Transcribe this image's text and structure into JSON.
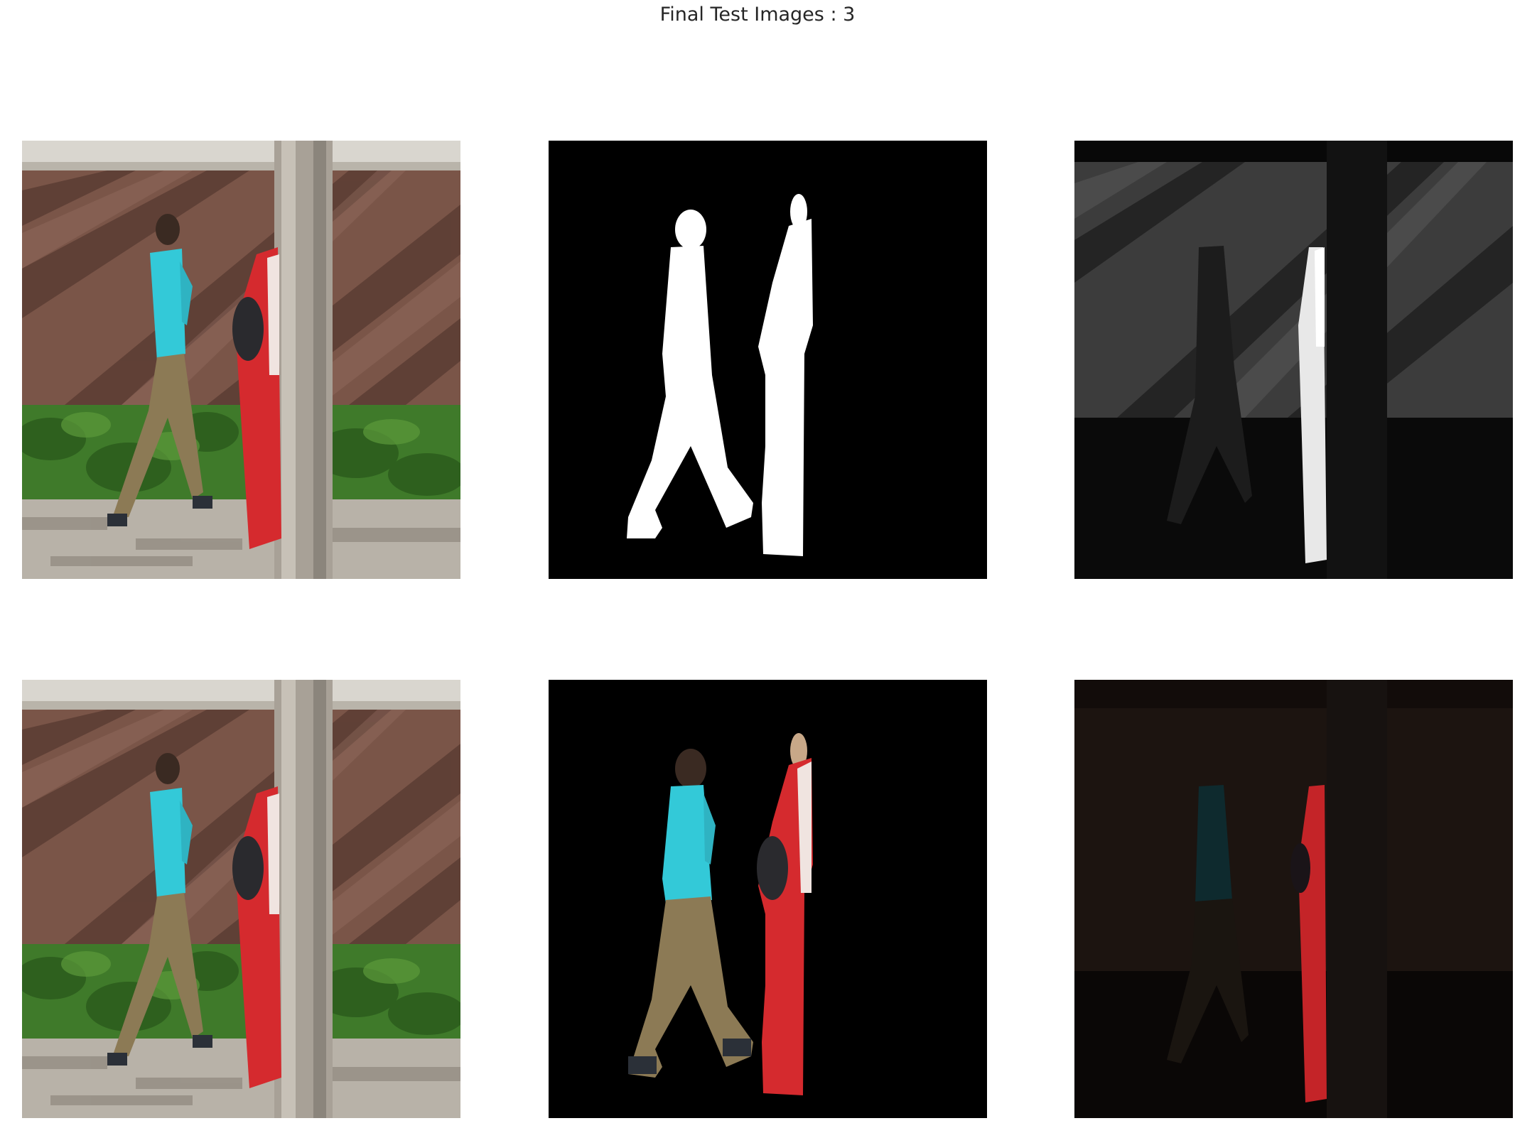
{
  "figure": {
    "title": "Final Test Images : 3"
  },
  "panels": [
    {
      "id": "r1c1",
      "kind": "input-photo"
    },
    {
      "id": "r1c2",
      "kind": "ground-truth-mask"
    },
    {
      "id": "r1c3",
      "kind": "predicted-mask"
    },
    {
      "id": "r2c1",
      "kind": "input-photo"
    },
    {
      "id": "r2c2",
      "kind": "masked-ground-truth"
    },
    {
      "id": "r2c3",
      "kind": "masked-prediction"
    }
  ]
}
